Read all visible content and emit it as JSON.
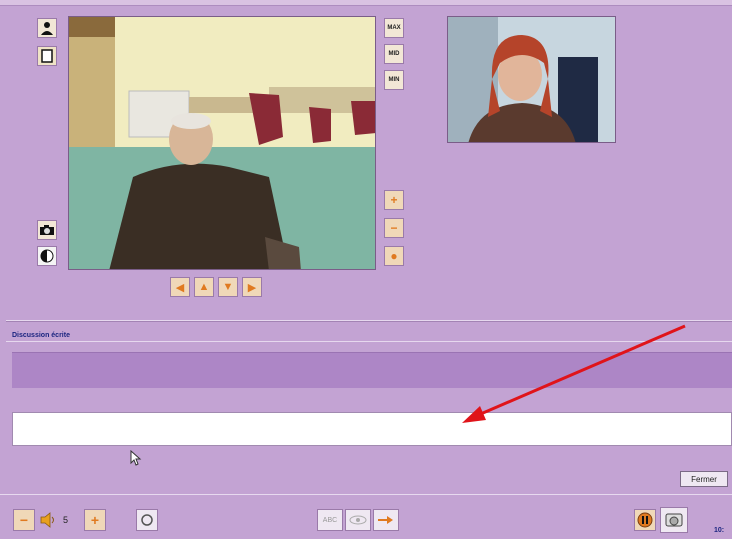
{
  "colors": {
    "background": "#c3a3d3",
    "chat_band": "#ad86c6",
    "title_text": "#1b2580",
    "annotation_arrow": "#e0141a"
  },
  "left_tools": {
    "contact_icon": "person-icon",
    "document_icon": "document-icon",
    "snapshot_icon": "camera-icon",
    "contrast_icon": "contrast-icon"
  },
  "zoom_tools": {
    "max_label": "MAX",
    "mid_label": "MID",
    "min_label": "MIN"
  },
  "camera_controls": {
    "zoom_in": "+",
    "zoom_out": "−",
    "focus": "●"
  },
  "pan_controls": [
    "◀",
    "▲",
    "▼",
    "▶"
  ],
  "chat": {
    "section_title": "Discussion écrite",
    "input_value": "",
    "close_label": "Fermer"
  },
  "bottom_bar": {
    "volume_down": "−",
    "volume_level": "5",
    "volume_up": "+",
    "abc_label": "ABC",
    "status_text": "10:"
  }
}
